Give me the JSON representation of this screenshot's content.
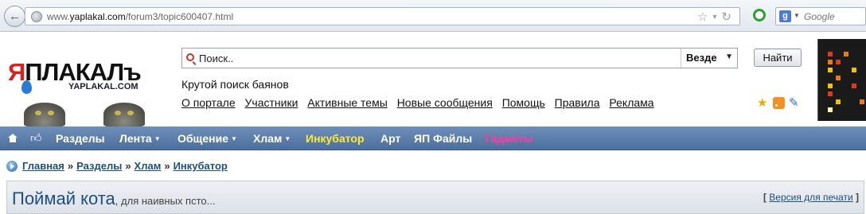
{
  "browser": {
    "url_prefix": "www.",
    "url_domain": "yaplakal.com",
    "url_path": "/forum3/topic600407.html",
    "search_engine_label": "g",
    "search_placeholder": "Google"
  },
  "header": {
    "logo_text_red": "Я",
    "logo_text": "ПЛАКАЛъ",
    "logo_sub": "YAPLAKAL.COM",
    "search_placeholder": "Поиск..",
    "search_scope": "Везде",
    "search_button": "Найти",
    "tagline": "Крутой поиск баянов",
    "nav_links": [
      "О портале",
      "Участники",
      "Активные темы",
      "Новые сообщения",
      "Помощь",
      "Правила",
      "Реклама"
    ],
    "icons": [
      "star-icon",
      "rss-icon",
      "pencil-icon"
    ]
  },
  "navbar": {
    "items": [
      {
        "label": "Разделы",
        "dropdown": false
      },
      {
        "label": "Лента",
        "dropdown": true
      },
      {
        "label": "Общение",
        "dropdown": true
      },
      {
        "label": "Хлам",
        "dropdown": true
      },
      {
        "label": "Инкубатор",
        "dropdown": false,
        "color": "#ffe838"
      },
      {
        "label": "Арт",
        "dropdown": false
      },
      {
        "label": "ЯП Файлы",
        "dropdown": false
      },
      {
        "label": "Гаджеты",
        "dropdown": false,
        "color": "#ff3aa8"
      }
    ],
    "caret": "▼"
  },
  "breadcrumb": {
    "items": [
      "Главная",
      "Разделы",
      "Хлам",
      "Инкубатор"
    ],
    "separator": "»"
  },
  "topic": {
    "title": "Поймай кота",
    "description": ", для наивных псто...",
    "print_open": "[ ",
    "print_label": "Версия для печати",
    "print_close": " ]"
  }
}
